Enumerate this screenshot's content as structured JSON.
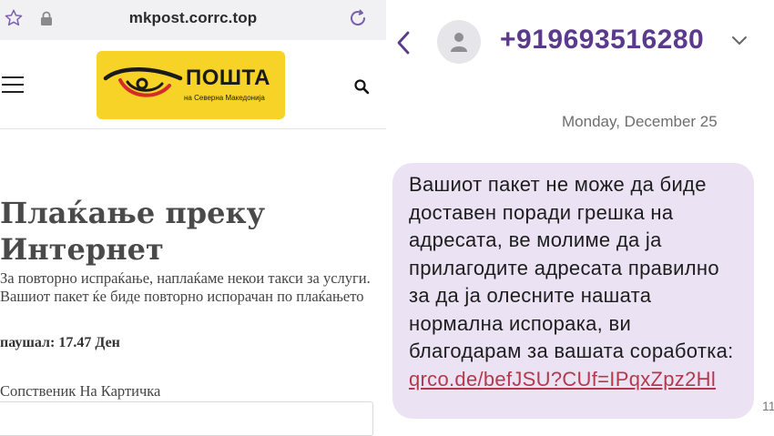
{
  "browser": {
    "url": "mkpost.corrc.top"
  },
  "site": {
    "logo_title": "ПОШТА",
    "logo_subtitle": "на Северна Македонија",
    "brand_color": "#f7d227"
  },
  "page": {
    "title_line1": "Плаќање преку",
    "title_line2": "Интернет",
    "description": "За повторно испраќање, наплаќаме некои такси за услуги. Вашиот пакет ќе биде повторно испорачан по плаќањето",
    "amount": "паушал: 17.47 Ден",
    "card_owner_label": "Сопственик На Картичка",
    "card_owner_value": ""
  },
  "sms": {
    "sender": "+919693516280",
    "date_separator": "Monday, December 25",
    "message_text": "Вашиот пакет не може да биде доставен поради грешка на адресата, ве молиме да ја прилагодите адресата правилно за да ја олесните нашата нормална испорака, ви благодарам за вашата соработка: ",
    "message_link": "qrco.de/befJSU?CUf=IPqxZpz2Hl",
    "time_fragment": "11",
    "accent_color": "#5b3a8c",
    "bubble_color": "#ebe3f4"
  },
  "icons": [
    "star-icon",
    "lock-icon",
    "reload-icon",
    "menu-icon",
    "search-icon",
    "back-icon",
    "avatar-icon",
    "chevron-down-icon"
  ]
}
